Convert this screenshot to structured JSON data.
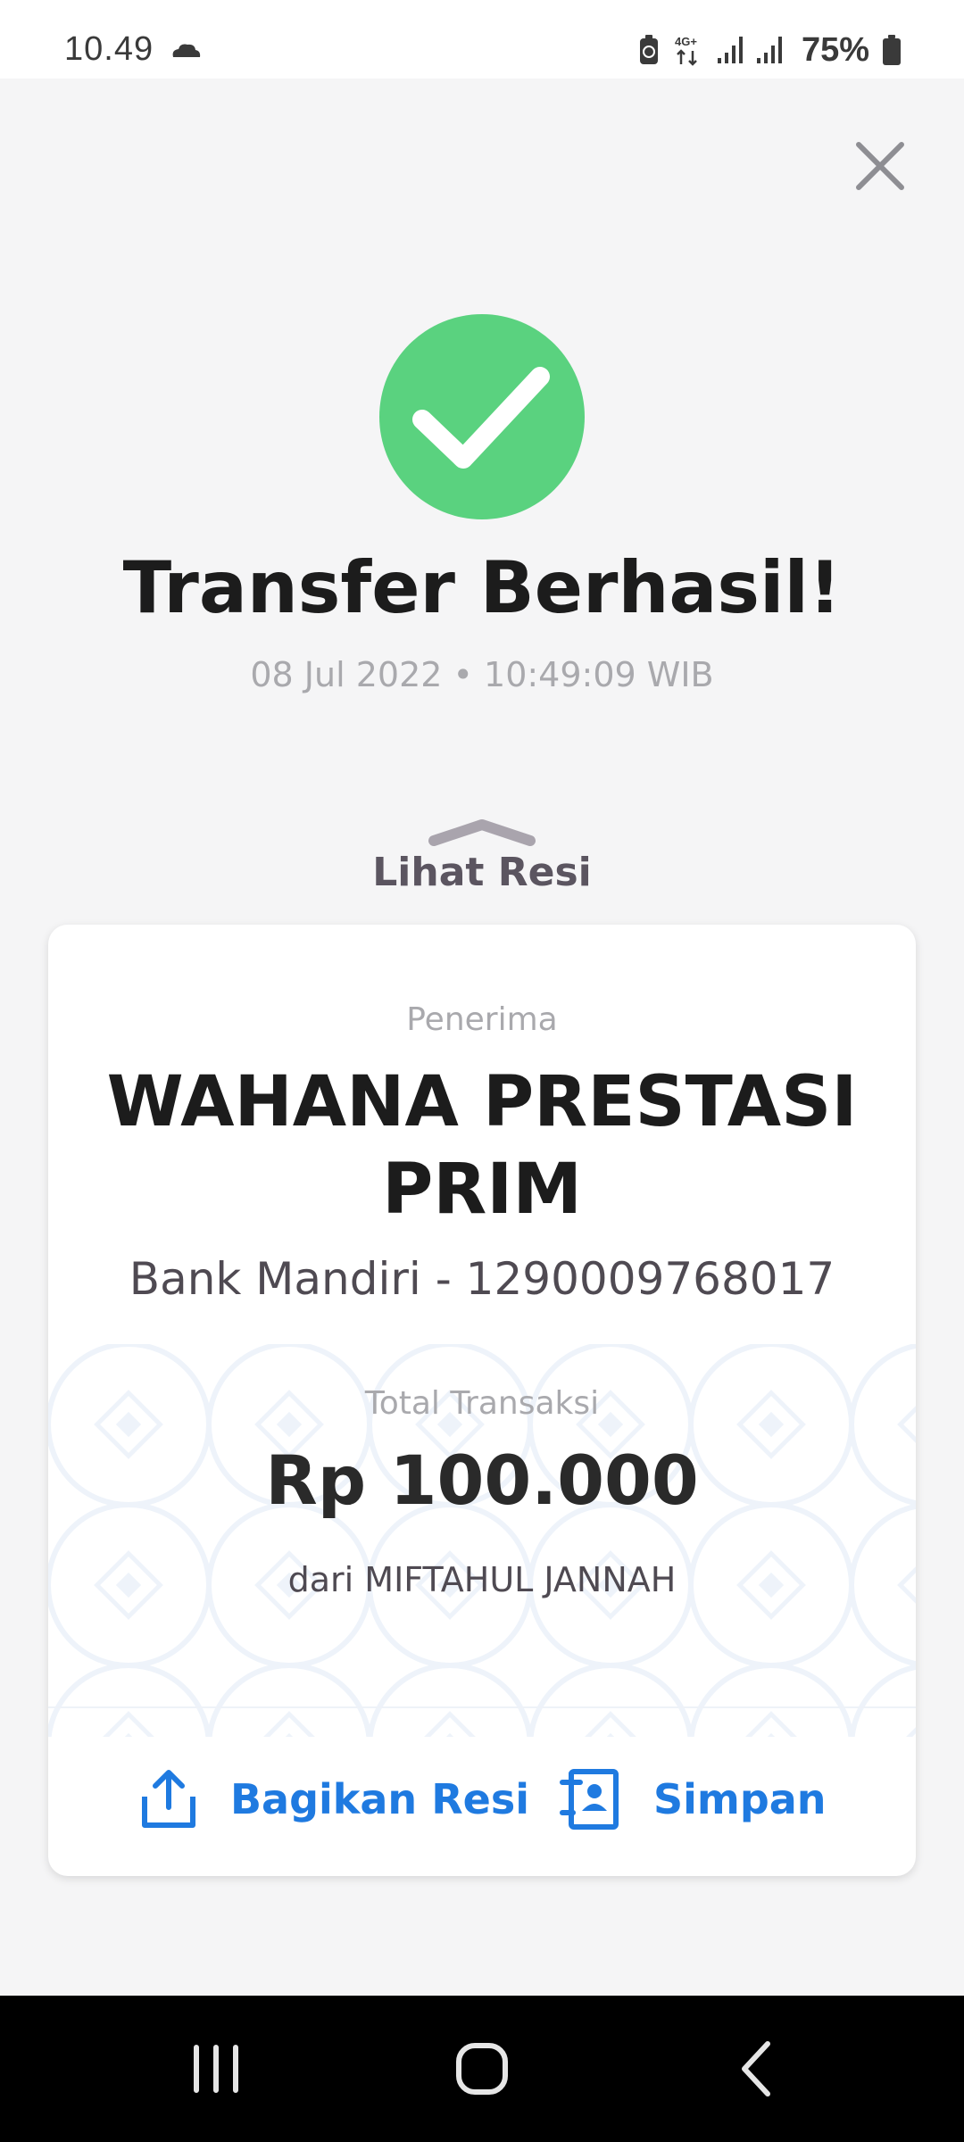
{
  "status_bar": {
    "time": "10.49",
    "network": "4G+",
    "battery": "75%"
  },
  "header": {
    "close_icon": "close-icon"
  },
  "result": {
    "icon": "check-icon",
    "title": "Transfer Berhasil!",
    "datetime": "08 Jul 2022 • 10:49:09 WIB",
    "status_color": "#5ad27f"
  },
  "receipt_toggle": {
    "label": "Lihat Resi"
  },
  "card": {
    "recipient_label": "Penerima",
    "recipient_name": "WAHANA PRESTASI PRIM",
    "recipient_bank": "Bank Mandiri - 1290009768017",
    "total_label": "Total Transaksi",
    "amount": "Rp 100.000",
    "from": "dari MIFTAHUL JANNAH",
    "share_label": "Bagikan Resi",
    "save_label": "Simpan",
    "accent_color": "#1f7ae0"
  }
}
